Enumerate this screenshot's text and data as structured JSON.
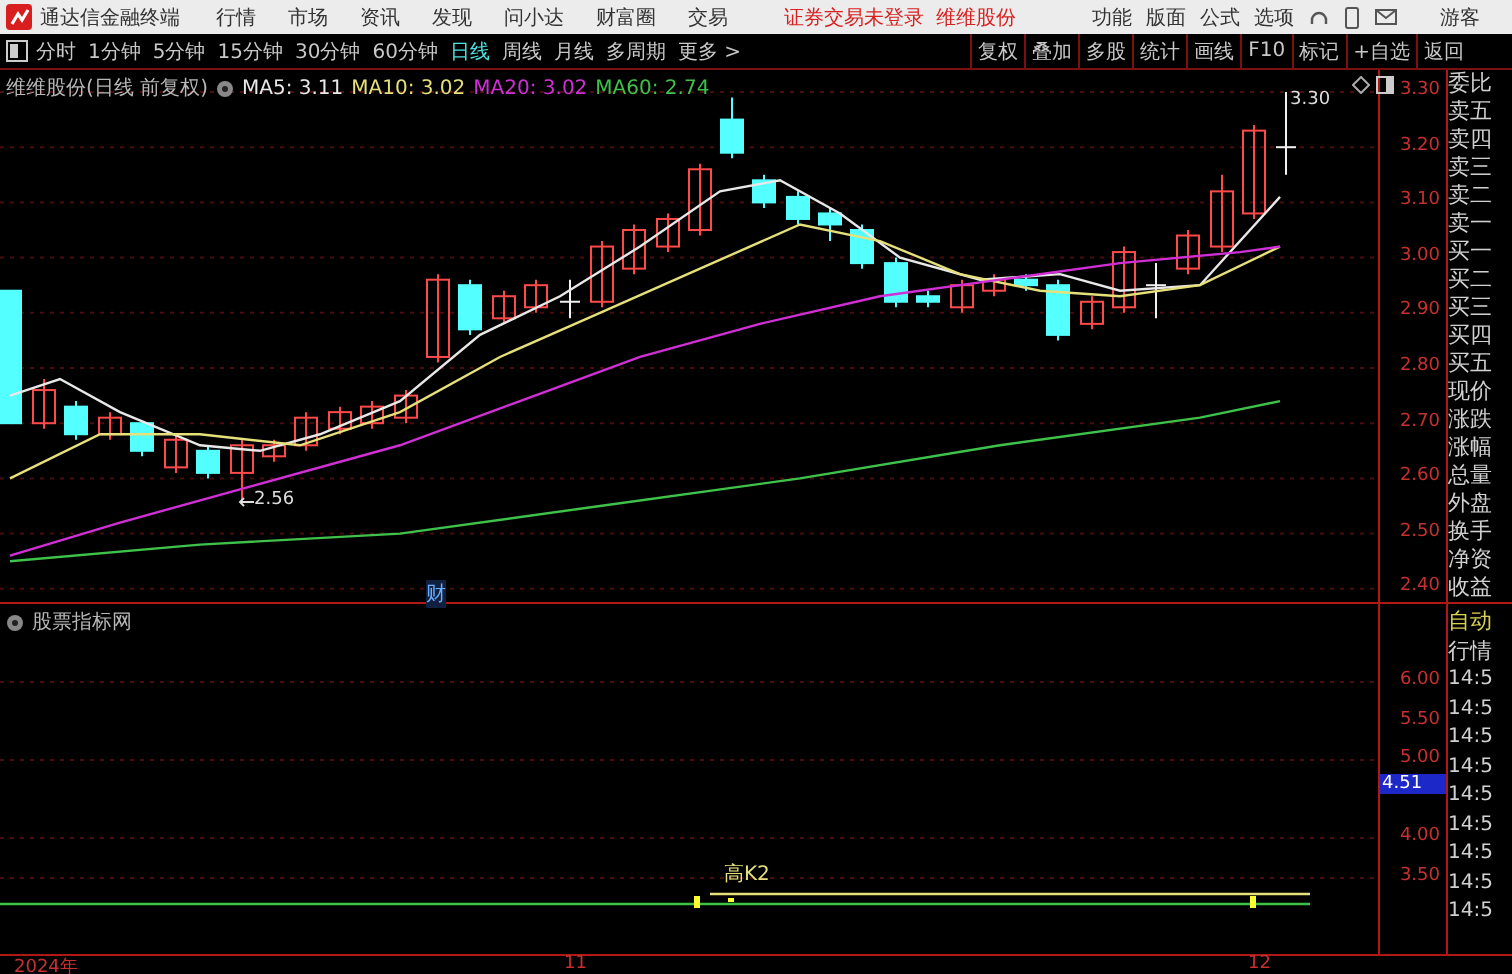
{
  "app": {
    "title": "通达信金融终端",
    "menu": [
      "行情",
      "市场",
      "资讯",
      "发现",
      "问小达",
      "财富圈",
      "交易"
    ],
    "login_status": "证券交易未登录",
    "stock_name": "维维股份",
    "tools": [
      "功能",
      "版面",
      "公式",
      "选项"
    ],
    "user": "游客"
  },
  "toolbar": {
    "periods": [
      {
        "label": "分时",
        "selected": false
      },
      {
        "label": "1分钟",
        "selected": false
      },
      {
        "label": "5分钟",
        "selected": false
      },
      {
        "label": "15分钟",
        "selected": false
      },
      {
        "label": "30分钟",
        "selected": false
      },
      {
        "label": "60分钟",
        "selected": false
      },
      {
        "label": "日线",
        "selected": true
      },
      {
        "label": "周线",
        "selected": false
      },
      {
        "label": "月线",
        "selected": false
      },
      {
        "label": "多周期",
        "selected": false
      },
      {
        "label": "更多 >",
        "selected": false
      }
    ],
    "actions": [
      "复权",
      "叠加",
      "多股",
      "统计",
      "画线",
      "F10",
      "标记",
      "+自选",
      "返回"
    ]
  },
  "chart": {
    "title": "维维股份(日线 前复权)",
    "ma": [
      {
        "label": "MA5: 3.11",
        "color": "#e8e8e8"
      },
      {
        "label": "MA10: 3.02",
        "color": "#e6e07a"
      },
      {
        "label": "MA20: 3.02",
        "color": "#d02fd6"
      },
      {
        "label": "MA60: 2.74",
        "color": "#3fc24a"
      }
    ],
    "price_axis": [
      "3.30",
      "3.20",
      "3.10",
      "3.00",
      "2.90",
      "2.80",
      "2.70",
      "2.60",
      "2.50",
      "2.40"
    ],
    "high_label": "3.30",
    "low_label": "2.56",
    "event_marker": "财"
  },
  "indicator": {
    "title": "股票指标网",
    "axis": [
      "6.00",
      "5.50",
      "5.00",
      "4.00",
      "3.50"
    ],
    "current_value": "4.51",
    "signal_label": "高K2"
  },
  "date_axis": [
    "2024年",
    "11",
    "12"
  ],
  "quote_panel": {
    "labels": [
      "委比",
      "卖五",
      "卖四",
      "卖三",
      "卖二",
      "卖一",
      "买一",
      "买二",
      "买三",
      "买四",
      "买五",
      "现价",
      "涨跌",
      "涨幅",
      "总量",
      "外盘",
      "换手",
      "净资",
      "收益"
    ],
    "mode": "自动",
    "section": "行情",
    "times": [
      "14:5",
      "14:5",
      "14:5",
      "14:5",
      "14:5",
      "14:5",
      "14:5",
      "14:5",
      "14:5"
    ]
  }
}
